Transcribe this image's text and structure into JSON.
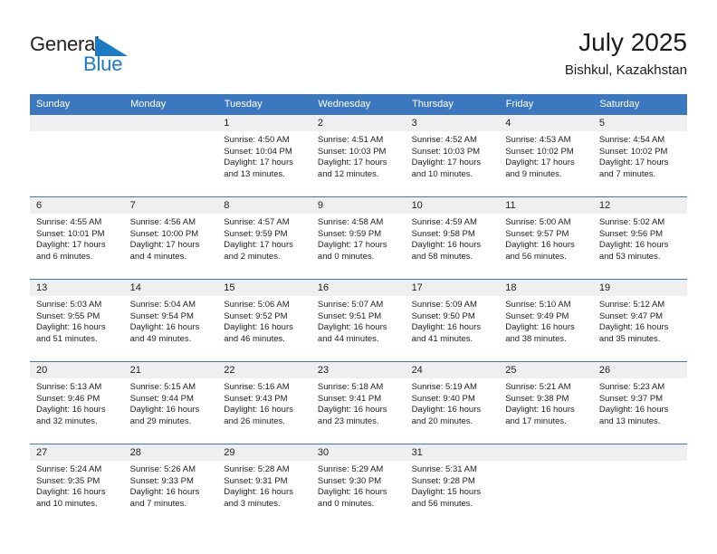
{
  "brand": {
    "name_line1": "General",
    "name_line2": "Blue",
    "accent_color": "#1a7bc4"
  },
  "header": {
    "title": "July 2025",
    "subtitle": "Bishkul, Kazakhstan",
    "header_bg_color": "#3c78bf"
  },
  "weekday_headers": [
    "Sunday",
    "Monday",
    "Tuesday",
    "Wednesday",
    "Thursday",
    "Friday",
    "Saturday"
  ],
  "labels": {
    "sunrise": "Sunrise:",
    "sunset": "Sunset:",
    "daylight": "Daylight:"
  },
  "weeks": [
    [
      {
        "day": "",
        "sunrise": "",
        "sunset": "",
        "daylight_line1": "",
        "daylight_line2": ""
      },
      {
        "day": "",
        "sunrise": "",
        "sunset": "",
        "daylight_line1": "",
        "daylight_line2": ""
      },
      {
        "day": "1",
        "sunrise": "Sunrise: 4:50 AM",
        "sunset": "Sunset: 10:04 PM",
        "daylight_line1": "Daylight: 17 hours",
        "daylight_line2": "and 13 minutes."
      },
      {
        "day": "2",
        "sunrise": "Sunrise: 4:51 AM",
        "sunset": "Sunset: 10:03 PM",
        "daylight_line1": "Daylight: 17 hours",
        "daylight_line2": "and 12 minutes."
      },
      {
        "day": "3",
        "sunrise": "Sunrise: 4:52 AM",
        "sunset": "Sunset: 10:03 PM",
        "daylight_line1": "Daylight: 17 hours",
        "daylight_line2": "and 10 minutes."
      },
      {
        "day": "4",
        "sunrise": "Sunrise: 4:53 AM",
        "sunset": "Sunset: 10:02 PM",
        "daylight_line1": "Daylight: 17 hours",
        "daylight_line2": "and 9 minutes."
      },
      {
        "day": "5",
        "sunrise": "Sunrise: 4:54 AM",
        "sunset": "Sunset: 10:02 PM",
        "daylight_line1": "Daylight: 17 hours",
        "daylight_line2": "and 7 minutes."
      }
    ],
    [
      {
        "day": "6",
        "sunrise": "Sunrise: 4:55 AM",
        "sunset": "Sunset: 10:01 PM",
        "daylight_line1": "Daylight: 17 hours",
        "daylight_line2": "and 6 minutes."
      },
      {
        "day": "7",
        "sunrise": "Sunrise: 4:56 AM",
        "sunset": "Sunset: 10:00 PM",
        "daylight_line1": "Daylight: 17 hours",
        "daylight_line2": "and 4 minutes."
      },
      {
        "day": "8",
        "sunrise": "Sunrise: 4:57 AM",
        "sunset": "Sunset: 9:59 PM",
        "daylight_line1": "Daylight: 17 hours",
        "daylight_line2": "and 2 minutes."
      },
      {
        "day": "9",
        "sunrise": "Sunrise: 4:58 AM",
        "sunset": "Sunset: 9:59 PM",
        "daylight_line1": "Daylight: 17 hours",
        "daylight_line2": "and 0 minutes."
      },
      {
        "day": "10",
        "sunrise": "Sunrise: 4:59 AM",
        "sunset": "Sunset: 9:58 PM",
        "daylight_line1": "Daylight: 16 hours",
        "daylight_line2": "and 58 minutes."
      },
      {
        "day": "11",
        "sunrise": "Sunrise: 5:00 AM",
        "sunset": "Sunset: 9:57 PM",
        "daylight_line1": "Daylight: 16 hours",
        "daylight_line2": "and 56 minutes."
      },
      {
        "day": "12",
        "sunrise": "Sunrise: 5:02 AM",
        "sunset": "Sunset: 9:56 PM",
        "daylight_line1": "Daylight: 16 hours",
        "daylight_line2": "and 53 minutes."
      }
    ],
    [
      {
        "day": "13",
        "sunrise": "Sunrise: 5:03 AM",
        "sunset": "Sunset: 9:55 PM",
        "daylight_line1": "Daylight: 16 hours",
        "daylight_line2": "and 51 minutes."
      },
      {
        "day": "14",
        "sunrise": "Sunrise: 5:04 AM",
        "sunset": "Sunset: 9:54 PM",
        "daylight_line1": "Daylight: 16 hours",
        "daylight_line2": "and 49 minutes."
      },
      {
        "day": "15",
        "sunrise": "Sunrise: 5:06 AM",
        "sunset": "Sunset: 9:52 PM",
        "daylight_line1": "Daylight: 16 hours",
        "daylight_line2": "and 46 minutes."
      },
      {
        "day": "16",
        "sunrise": "Sunrise: 5:07 AM",
        "sunset": "Sunset: 9:51 PM",
        "daylight_line1": "Daylight: 16 hours",
        "daylight_line2": "and 44 minutes."
      },
      {
        "day": "17",
        "sunrise": "Sunrise: 5:09 AM",
        "sunset": "Sunset: 9:50 PM",
        "daylight_line1": "Daylight: 16 hours",
        "daylight_line2": "and 41 minutes."
      },
      {
        "day": "18",
        "sunrise": "Sunrise: 5:10 AM",
        "sunset": "Sunset: 9:49 PM",
        "daylight_line1": "Daylight: 16 hours",
        "daylight_line2": "and 38 minutes."
      },
      {
        "day": "19",
        "sunrise": "Sunrise: 5:12 AM",
        "sunset": "Sunset: 9:47 PM",
        "daylight_line1": "Daylight: 16 hours",
        "daylight_line2": "and 35 minutes."
      }
    ],
    [
      {
        "day": "20",
        "sunrise": "Sunrise: 5:13 AM",
        "sunset": "Sunset: 9:46 PM",
        "daylight_line1": "Daylight: 16 hours",
        "daylight_line2": "and 32 minutes."
      },
      {
        "day": "21",
        "sunrise": "Sunrise: 5:15 AM",
        "sunset": "Sunset: 9:44 PM",
        "daylight_line1": "Daylight: 16 hours",
        "daylight_line2": "and 29 minutes."
      },
      {
        "day": "22",
        "sunrise": "Sunrise: 5:16 AM",
        "sunset": "Sunset: 9:43 PM",
        "daylight_line1": "Daylight: 16 hours",
        "daylight_line2": "and 26 minutes."
      },
      {
        "day": "23",
        "sunrise": "Sunrise: 5:18 AM",
        "sunset": "Sunset: 9:41 PM",
        "daylight_line1": "Daylight: 16 hours",
        "daylight_line2": "and 23 minutes."
      },
      {
        "day": "24",
        "sunrise": "Sunrise: 5:19 AM",
        "sunset": "Sunset: 9:40 PM",
        "daylight_line1": "Daylight: 16 hours",
        "daylight_line2": "and 20 minutes."
      },
      {
        "day": "25",
        "sunrise": "Sunrise: 5:21 AM",
        "sunset": "Sunset: 9:38 PM",
        "daylight_line1": "Daylight: 16 hours",
        "daylight_line2": "and 17 minutes."
      },
      {
        "day": "26",
        "sunrise": "Sunrise: 5:23 AM",
        "sunset": "Sunset: 9:37 PM",
        "daylight_line1": "Daylight: 16 hours",
        "daylight_line2": "and 13 minutes."
      }
    ],
    [
      {
        "day": "27",
        "sunrise": "Sunrise: 5:24 AM",
        "sunset": "Sunset: 9:35 PM",
        "daylight_line1": "Daylight: 16 hours",
        "daylight_line2": "and 10 minutes."
      },
      {
        "day": "28",
        "sunrise": "Sunrise: 5:26 AM",
        "sunset": "Sunset: 9:33 PM",
        "daylight_line1": "Daylight: 16 hours",
        "daylight_line2": "and 7 minutes."
      },
      {
        "day": "29",
        "sunrise": "Sunrise: 5:28 AM",
        "sunset": "Sunset: 9:31 PM",
        "daylight_line1": "Daylight: 16 hours",
        "daylight_line2": "and 3 minutes."
      },
      {
        "day": "30",
        "sunrise": "Sunrise: 5:29 AM",
        "sunset": "Sunset: 9:30 PM",
        "daylight_line1": "Daylight: 16 hours",
        "daylight_line2": "and 0 minutes."
      },
      {
        "day": "31",
        "sunrise": "Sunrise: 5:31 AM",
        "sunset": "Sunset: 9:28 PM",
        "daylight_line1": "Daylight: 15 hours",
        "daylight_line2": "and 56 minutes."
      },
      {
        "day": "",
        "sunrise": "",
        "sunset": "",
        "daylight_line1": "",
        "daylight_line2": ""
      },
      {
        "day": "",
        "sunrise": "",
        "sunset": "",
        "daylight_line1": "",
        "daylight_line2": ""
      }
    ]
  ]
}
